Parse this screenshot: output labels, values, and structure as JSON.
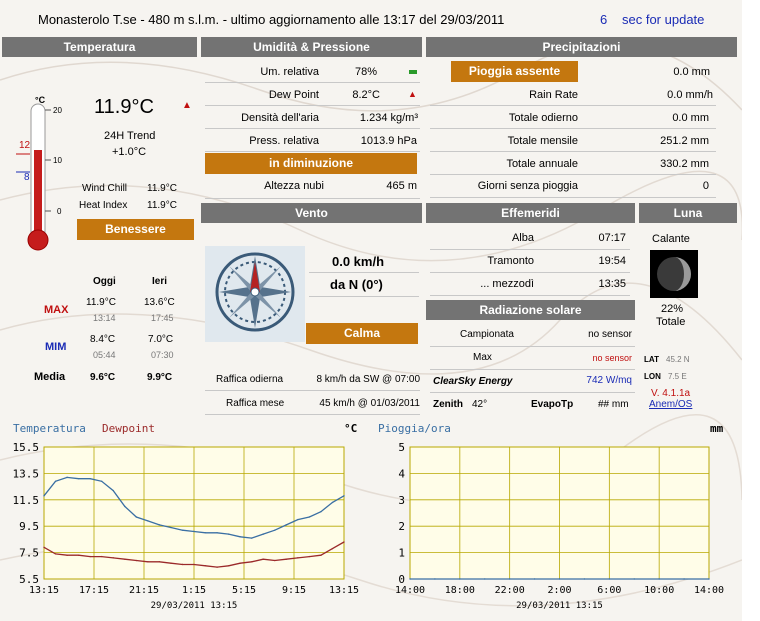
{
  "header": {
    "title": "Monasterolo T.se - 480 m s.l.m. - ultimo aggiornamento alle 13:17 del 29/03/2011",
    "countdown": "6",
    "countdown_label": "sec for update"
  },
  "sections": {
    "temperatura": "Temperatura",
    "umidita": "Umidità & Pressione",
    "precipitazioni": "Precipitazioni",
    "vento": "Vento",
    "effemeridi": "Effemeridi",
    "luna": "Luna",
    "radiazione": "Radiazione solare"
  },
  "temperature": {
    "current": "11.9°C",
    "trend_label": "24H Trend",
    "trend_value": "+1.0°C",
    "thermo_unit": "°C",
    "thermo_ticks": [
      "20",
      "10",
      "0"
    ],
    "thermo_max": "12",
    "thermo_min": "8",
    "wind_chill_label": "Wind Chill",
    "wind_chill": "11.9°C",
    "heat_index_label": "Heat Index",
    "heat_index": "11.9°C",
    "comfort": "Benessere",
    "today_label": "Oggi",
    "yesterday_label": "Ieri",
    "max_label": "MAX",
    "min_label": "MIM",
    "avg_label": "Media",
    "today_max": "11.9°C",
    "today_max_time": "13:14",
    "yesterday_max": "13.6°C",
    "yesterday_max_time": "17:45",
    "today_min": "8.4°C",
    "today_min_time": "05:44",
    "yesterday_min": "7.0°C",
    "yesterday_min_time": "07:30",
    "today_avg": "9.6°C",
    "yesterday_avg": "9.9°C",
    "accent_color": "#c4770f"
  },
  "humidity": {
    "rows": [
      {
        "label": "Um. relativa",
        "value": "78%"
      },
      {
        "label": "Dew Point",
        "value": "8.2°C"
      },
      {
        "label": "Densità dell'aria",
        "value": "1.234 kg/m³"
      },
      {
        "label": "Press. relativa",
        "value": "1013.9 hPa"
      }
    ],
    "trend": "in diminuzione",
    "cloud_label": "Altezza nubi",
    "cloud_value": "465 m"
  },
  "precip": {
    "status": "Pioggia assente",
    "status_value": "0.0 mm",
    "rows": [
      {
        "label": "Rain Rate",
        "value": "0.0 mm/h"
      },
      {
        "label": "Totale odierno",
        "value": "0.0 mm"
      },
      {
        "label": "Totale mensile",
        "value": "251.2 mm"
      },
      {
        "label": "Totale annuale",
        "value": "330.2 mm"
      },
      {
        "label": "Giorni senza pioggia",
        "value": "0"
      }
    ]
  },
  "wind": {
    "speed": "0.0 km/h",
    "direction": "da N (0°)",
    "state": "Calma",
    "gust_today_label": "Raffica odierna",
    "gust_today": "8 km/h da SW @ 07:00",
    "gust_month_label": "Raffica mese",
    "gust_month": "45 km/h @ 01/03/2011"
  },
  "ephemeris": {
    "rows": [
      {
        "label": "Alba",
        "value": "07:17"
      },
      {
        "label": "Tramonto",
        "value": "19:54"
      },
      {
        "label": "... mezzodì",
        "value": "13:35"
      }
    ]
  },
  "moon": {
    "phase": "Calante",
    "percent": "22%",
    "percent_label": "Totale"
  },
  "solar": {
    "sampled_label": "Campionata",
    "sampled": "no sensor",
    "max_label": "Max",
    "max": "no sensor",
    "clearsky_label": "ClearSky Energy",
    "clearsky": "742 W/mq",
    "zenith_label": "Zenith",
    "zenith": "42°",
    "evapo_label": "EvapoTp",
    "evapo": "## mm"
  },
  "location": {
    "lat_label": "LAT",
    "lat": "45.2 N",
    "lon_label": "LON",
    "lon": "7.5 E",
    "version": "V. 4.1.1a",
    "link": "Anem/OS"
  },
  "chart_data": [
    {
      "type": "line",
      "title": "",
      "legend": [
        "Temperatura",
        "Dewpoint"
      ],
      "unit": "°C",
      "ylim": [
        5.5,
        15.5
      ],
      "yticks": [
        "15.5",
        "13.5",
        "11.5",
        "9.5",
        "7.5",
        "5.5"
      ],
      "xticks": [
        "13:15",
        "17:15",
        "21:15",
        "1:15",
        "5:15",
        "9:15",
        "13:15"
      ],
      "date_label": "29/03/2011 13:15",
      "series": [
        {
          "name": "Temperatura",
          "color": "#3a6fa3",
          "values": [
            11.8,
            12.9,
            13.2,
            13.1,
            13.1,
            12.9,
            12.2,
            11.0,
            10.2,
            9.9,
            9.6,
            9.4,
            9.2,
            9.1,
            9.0,
            9.0,
            8.9,
            8.7,
            8.6,
            8.9,
            9.2,
            9.6,
            10.0,
            10.2,
            10.6,
            11.3,
            11.8
          ]
        },
        {
          "name": "Dewpoint",
          "color": "#9b2a2a",
          "values": [
            7.9,
            7.4,
            7.3,
            7.3,
            7.2,
            7.2,
            7.1,
            7.0,
            6.9,
            6.8,
            6.8,
            6.7,
            6.6,
            6.6,
            6.5,
            6.4,
            6.5,
            6.7,
            6.8,
            7.0,
            6.9,
            7.0,
            7.1,
            7.2,
            7.3,
            7.8,
            8.3
          ]
        }
      ]
    },
    {
      "type": "line",
      "title": "Pioggia/ora",
      "unit": "mm",
      "ylim": [
        0,
        5
      ],
      "yticks": [
        "5",
        "4",
        "3",
        "2",
        "1",
        "0"
      ],
      "xticks": [
        "14:00",
        "18:00",
        "22:00",
        "2:00",
        "6:00",
        "10:00",
        "14:00"
      ],
      "date_label": "29/03/2011 13:15",
      "series": [
        {
          "name": "Pioggia/ora",
          "color": "#3a6fa3",
          "values": [
            0,
            0,
            0,
            0,
            0,
            0,
            0,
            0,
            0,
            0,
            0,
            0,
            0
          ]
        }
      ]
    }
  ]
}
